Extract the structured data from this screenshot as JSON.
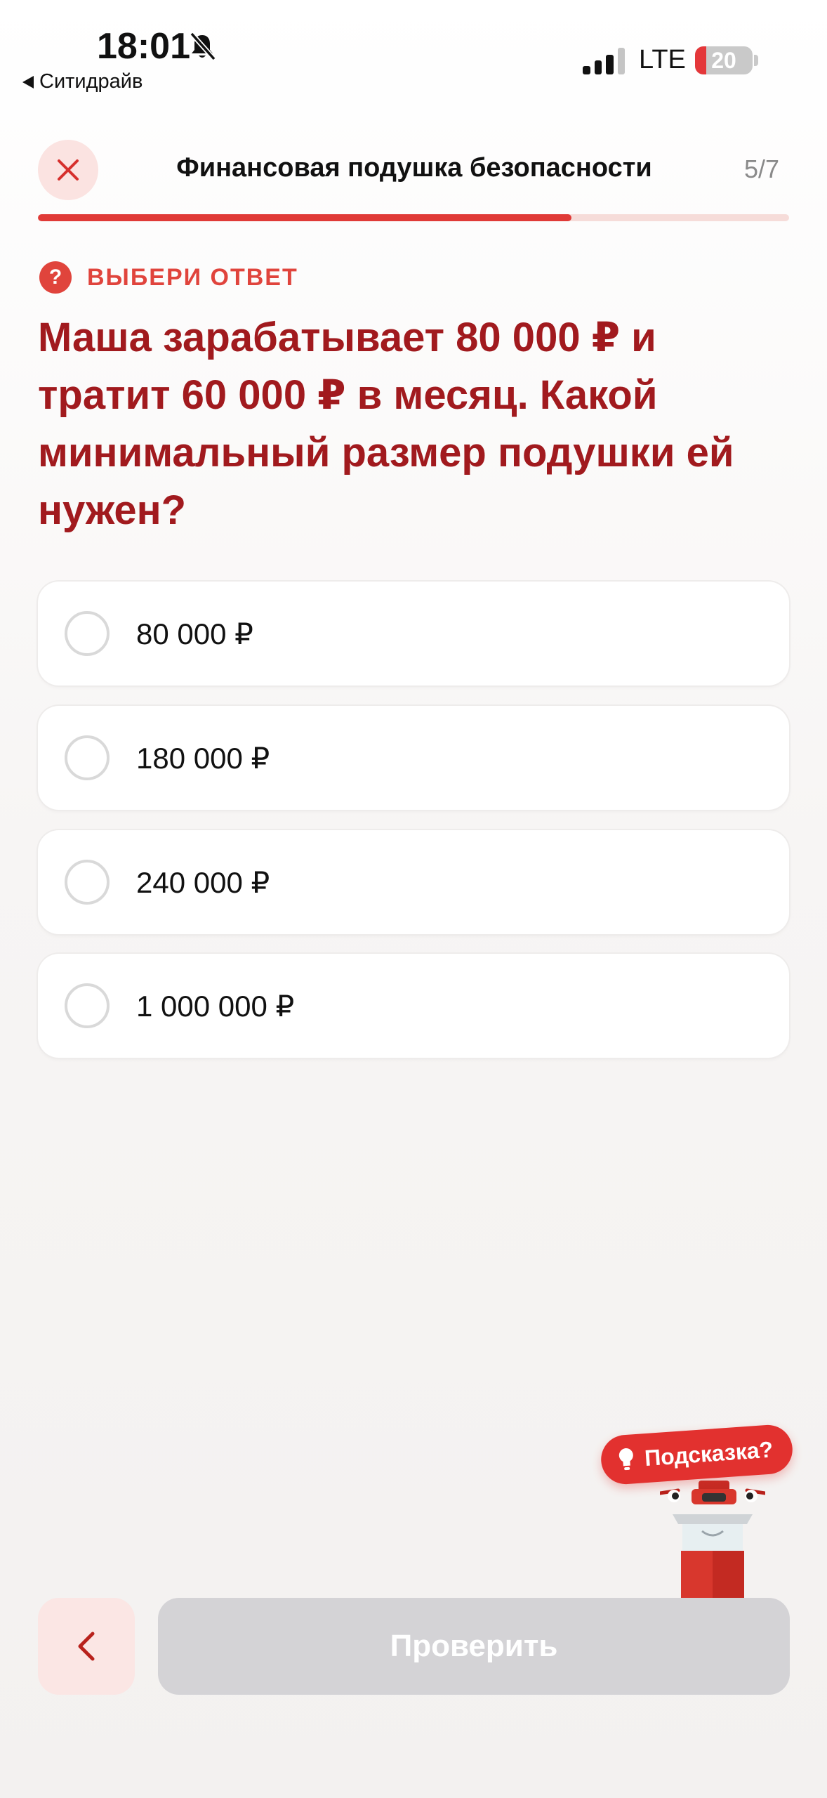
{
  "status_bar": {
    "time": "18:01",
    "back_app": "Ситидрайв",
    "network": "LTE",
    "battery": "20",
    "battery_level_percent": 20,
    "battery_color": "#e4373a"
  },
  "header": {
    "title": "Финансовая подушка безопасности",
    "counter": "5/7",
    "progress_fraction": 0.71,
    "accent": "#e03a37"
  },
  "question": {
    "label": "ВЫБЕРИ ОТВЕТ",
    "icon": "?",
    "text": "Маша зарабатывает 80 000 ₽ и тратит 60 000 ₽ в месяц. Какой минимальный размер подушки ей нужен?",
    "text_color": "#a11a1e"
  },
  "options": [
    {
      "label": "80 000 ₽"
    },
    {
      "label": "180 000 ₽"
    },
    {
      "label": "240 000 ₽"
    },
    {
      "label": "1 000 000 ₽"
    }
  ],
  "hint": {
    "label": "Подсказка?"
  },
  "footer": {
    "check_label": "Проверить"
  }
}
